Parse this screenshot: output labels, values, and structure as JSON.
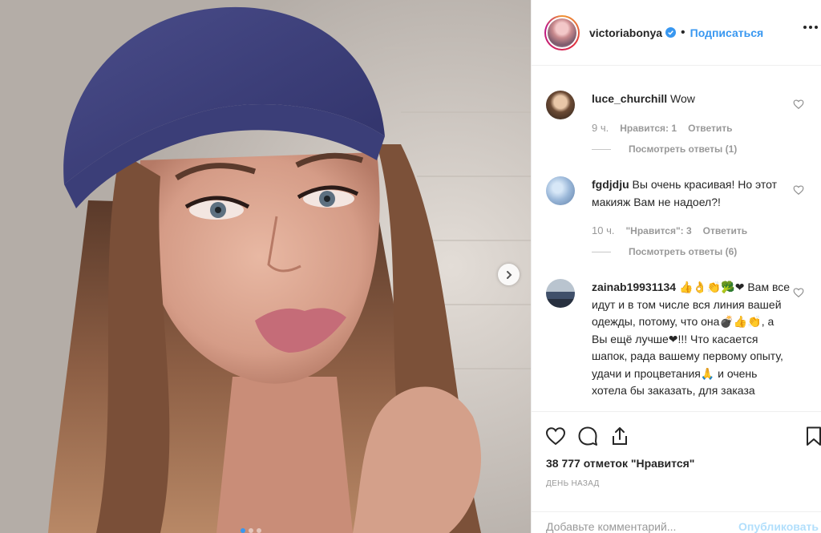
{
  "colors": {
    "accent": "#3897f0",
    "text": "#262626",
    "muted": "#999999",
    "like_heart": "#ed4956"
  },
  "post": {
    "username": "victoriabonya",
    "verified": true,
    "separator": "•",
    "follow_label": "Подписаться",
    "more_icon": "more-dots-icon",
    "carousel_next_icon": "chevron-right-icon"
  },
  "comments": [
    {
      "username": "luce_churchill",
      "text": "Wow",
      "time": "9 ч.",
      "likes": "Нравится: 1",
      "reply": "Ответить",
      "view_replies": "Посмотреть ответы (1)"
    },
    {
      "username": "fgdjdju",
      "text": "Вы очень красивая! Но этот макияж Вам не надоел?!",
      "time": "10 ч.",
      "likes": "\"Нравится\": 3",
      "reply": "Ответить",
      "view_replies": "Посмотреть ответы (6)"
    },
    {
      "username": "zainab19931134",
      "text": "👍👌👏🥦❤ Вам все идут и в том числе вся линия вашей одежды, потому, что она💣👍👏, а Вы ещё лучше❤!!! Что касается шапок, рада вашему первому опыту, удачи и процветания🙏 и очень хотела бы заказать, для заказа"
    }
  ],
  "actions": {
    "like_icon": "heart-icon",
    "comment_icon": "comment-bubble-icon",
    "share_icon": "share-icon",
    "save_icon": "bookmark-icon",
    "likes_count": "38 777 отметок \"Нравится\"",
    "date": "ДЕНЬ НАЗАД"
  },
  "composer": {
    "placeholder": "Добавьте комментарий...",
    "post_label": "Опубликовать"
  }
}
